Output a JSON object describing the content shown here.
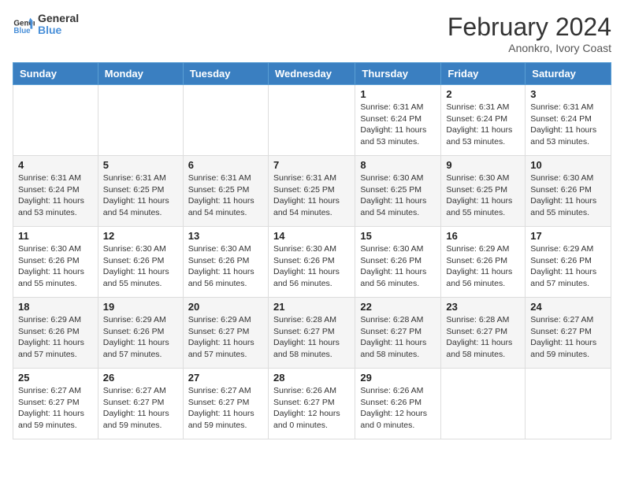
{
  "header": {
    "logo_line1": "General",
    "logo_line2": "Blue",
    "month_title": "February 2024",
    "subtitle": "Anonkro, Ivory Coast"
  },
  "days_of_week": [
    "Sunday",
    "Monday",
    "Tuesday",
    "Wednesday",
    "Thursday",
    "Friday",
    "Saturday"
  ],
  "weeks": [
    [
      {
        "day": "",
        "info": ""
      },
      {
        "day": "",
        "info": ""
      },
      {
        "day": "",
        "info": ""
      },
      {
        "day": "",
        "info": ""
      },
      {
        "day": "1",
        "info": "Sunrise: 6:31 AM\nSunset: 6:24 PM\nDaylight: 11 hours and 53 minutes."
      },
      {
        "day": "2",
        "info": "Sunrise: 6:31 AM\nSunset: 6:24 PM\nDaylight: 11 hours and 53 minutes."
      },
      {
        "day": "3",
        "info": "Sunrise: 6:31 AM\nSunset: 6:24 PM\nDaylight: 11 hours and 53 minutes."
      }
    ],
    [
      {
        "day": "4",
        "info": "Sunrise: 6:31 AM\nSunset: 6:24 PM\nDaylight: 11 hours and 53 minutes."
      },
      {
        "day": "5",
        "info": "Sunrise: 6:31 AM\nSunset: 6:25 PM\nDaylight: 11 hours and 54 minutes."
      },
      {
        "day": "6",
        "info": "Sunrise: 6:31 AM\nSunset: 6:25 PM\nDaylight: 11 hours and 54 minutes."
      },
      {
        "day": "7",
        "info": "Sunrise: 6:31 AM\nSunset: 6:25 PM\nDaylight: 11 hours and 54 minutes."
      },
      {
        "day": "8",
        "info": "Sunrise: 6:30 AM\nSunset: 6:25 PM\nDaylight: 11 hours and 54 minutes."
      },
      {
        "day": "9",
        "info": "Sunrise: 6:30 AM\nSunset: 6:25 PM\nDaylight: 11 hours and 55 minutes."
      },
      {
        "day": "10",
        "info": "Sunrise: 6:30 AM\nSunset: 6:26 PM\nDaylight: 11 hours and 55 minutes."
      }
    ],
    [
      {
        "day": "11",
        "info": "Sunrise: 6:30 AM\nSunset: 6:26 PM\nDaylight: 11 hours and 55 minutes."
      },
      {
        "day": "12",
        "info": "Sunrise: 6:30 AM\nSunset: 6:26 PM\nDaylight: 11 hours and 55 minutes."
      },
      {
        "day": "13",
        "info": "Sunrise: 6:30 AM\nSunset: 6:26 PM\nDaylight: 11 hours and 56 minutes."
      },
      {
        "day": "14",
        "info": "Sunrise: 6:30 AM\nSunset: 6:26 PM\nDaylight: 11 hours and 56 minutes."
      },
      {
        "day": "15",
        "info": "Sunrise: 6:30 AM\nSunset: 6:26 PM\nDaylight: 11 hours and 56 minutes."
      },
      {
        "day": "16",
        "info": "Sunrise: 6:29 AM\nSunset: 6:26 PM\nDaylight: 11 hours and 56 minutes."
      },
      {
        "day": "17",
        "info": "Sunrise: 6:29 AM\nSunset: 6:26 PM\nDaylight: 11 hours and 57 minutes."
      }
    ],
    [
      {
        "day": "18",
        "info": "Sunrise: 6:29 AM\nSunset: 6:26 PM\nDaylight: 11 hours and 57 minutes."
      },
      {
        "day": "19",
        "info": "Sunrise: 6:29 AM\nSunset: 6:26 PM\nDaylight: 11 hours and 57 minutes."
      },
      {
        "day": "20",
        "info": "Sunrise: 6:29 AM\nSunset: 6:27 PM\nDaylight: 11 hours and 57 minutes."
      },
      {
        "day": "21",
        "info": "Sunrise: 6:28 AM\nSunset: 6:27 PM\nDaylight: 11 hours and 58 minutes."
      },
      {
        "day": "22",
        "info": "Sunrise: 6:28 AM\nSunset: 6:27 PM\nDaylight: 11 hours and 58 minutes."
      },
      {
        "day": "23",
        "info": "Sunrise: 6:28 AM\nSunset: 6:27 PM\nDaylight: 11 hours and 58 minutes."
      },
      {
        "day": "24",
        "info": "Sunrise: 6:27 AM\nSunset: 6:27 PM\nDaylight: 11 hours and 59 minutes."
      }
    ],
    [
      {
        "day": "25",
        "info": "Sunrise: 6:27 AM\nSunset: 6:27 PM\nDaylight: 11 hours and 59 minutes."
      },
      {
        "day": "26",
        "info": "Sunrise: 6:27 AM\nSunset: 6:27 PM\nDaylight: 11 hours and 59 minutes."
      },
      {
        "day": "27",
        "info": "Sunrise: 6:27 AM\nSunset: 6:27 PM\nDaylight: 11 hours and 59 minutes."
      },
      {
        "day": "28",
        "info": "Sunrise: 6:26 AM\nSunset: 6:27 PM\nDaylight: 12 hours and 0 minutes."
      },
      {
        "day": "29",
        "info": "Sunrise: 6:26 AM\nSunset: 6:26 PM\nDaylight: 12 hours and 0 minutes."
      },
      {
        "day": "",
        "info": ""
      },
      {
        "day": "",
        "info": ""
      }
    ]
  ]
}
